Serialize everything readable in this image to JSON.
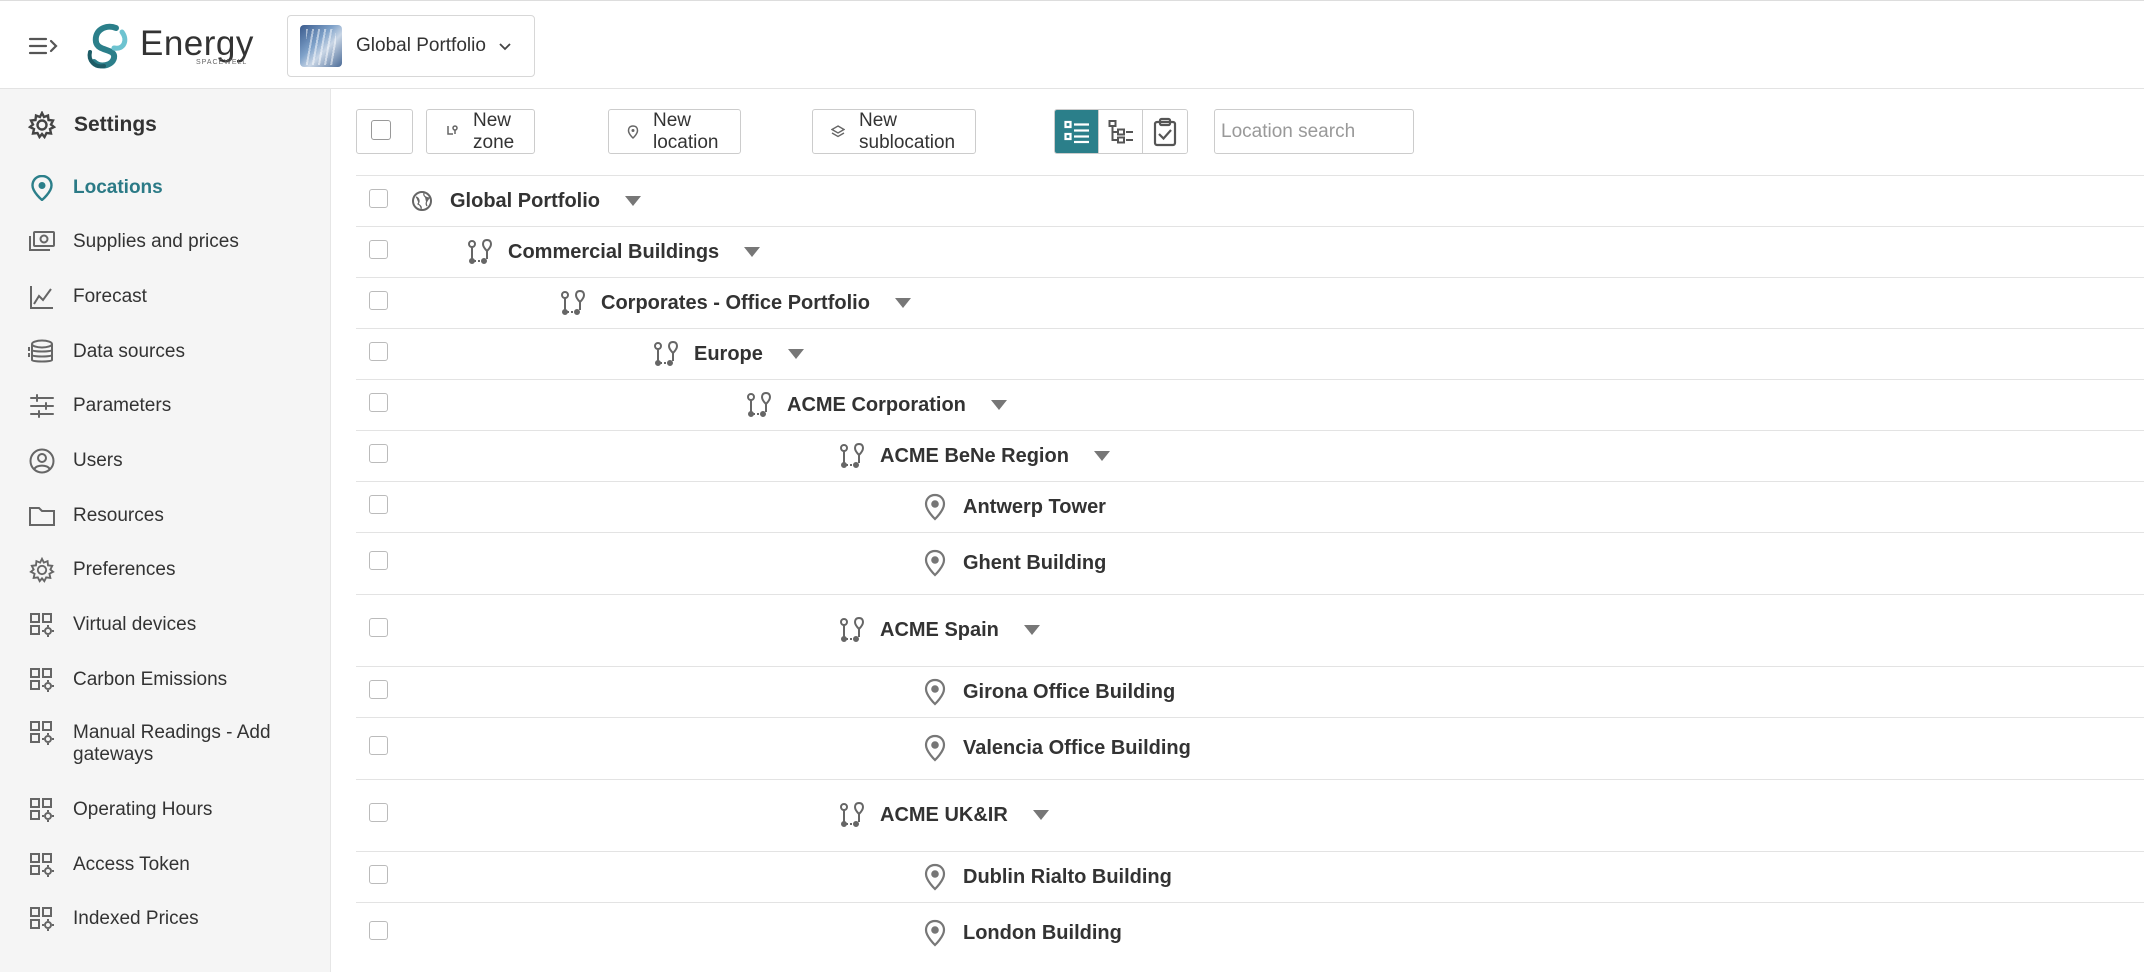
{
  "header": {
    "logo_text": "Energy",
    "logo_sub": "SPACEWELL",
    "portfolio": "Global Portfolio"
  },
  "sidebar": {
    "title": "Settings",
    "items": [
      {
        "label": "Locations",
        "icon": "location-pin-icon",
        "active": true
      },
      {
        "label": "Supplies and prices",
        "icon": "money-icon"
      },
      {
        "label": "Forecast",
        "icon": "chart-icon"
      },
      {
        "label": "Data sources",
        "icon": "database-icon"
      },
      {
        "label": "Parameters",
        "icon": "sliders-icon"
      },
      {
        "label": "Users",
        "icon": "user-icon"
      },
      {
        "label": "Resources",
        "icon": "folder-icon"
      },
      {
        "label": "Preferences",
        "icon": "gear-icon"
      },
      {
        "label": "Virtual devices",
        "icon": "grid-gear-icon"
      },
      {
        "label": "Carbon Emissions",
        "icon": "grid-gear-icon"
      },
      {
        "label": "Manual Readings - Add gateways",
        "icon": "grid-gear-icon"
      },
      {
        "label": "Operating Hours",
        "icon": "grid-gear-icon"
      },
      {
        "label": "Access Token",
        "icon": "grid-gear-icon"
      },
      {
        "label": "Indexed Prices",
        "icon": "grid-gear-icon"
      }
    ]
  },
  "toolbar": {
    "new_zone": "New zone",
    "new_location": "New location",
    "new_sublocation": "New sublocation",
    "search_placeholder": "Location search"
  },
  "tree": [
    {
      "label": "Global Portfolio",
      "type": "portfolio",
      "level": 0,
      "expandable": true
    },
    {
      "label": "Commercial Buildings",
      "type": "zone",
      "level": 1,
      "expandable": true
    },
    {
      "label": "Corporates - Office Portfolio",
      "type": "zone",
      "level": 2,
      "expandable": true
    },
    {
      "label": "Europe",
      "type": "zone",
      "level": 3,
      "expandable": true
    },
    {
      "label": "ACME Corporation",
      "type": "zone",
      "level": 4,
      "expandable": true
    },
    {
      "label": "ACME BeNe Region",
      "type": "zone",
      "level": 5,
      "expandable": true
    },
    {
      "label": "Antwerp Tower",
      "type": "location",
      "level": 6,
      "expandable": false
    },
    {
      "label": "Ghent Building",
      "type": "location",
      "level": 6,
      "expandable": false
    },
    {
      "label": "ACME Spain",
      "type": "zone",
      "level": 5,
      "expandable": true
    },
    {
      "label": "Girona Office Building",
      "type": "location",
      "level": 6,
      "expandable": false
    },
    {
      "label": "Valencia Office Building",
      "type": "location",
      "level": 6,
      "expandable": false
    },
    {
      "label": "ACME UK&IR",
      "type": "zone",
      "level": 5,
      "expandable": true
    },
    {
      "label": "Dublin Rialto Building",
      "type": "location",
      "level": 6,
      "expandable": false
    },
    {
      "label": "London Building",
      "type": "location",
      "level": 6,
      "expandable": false
    }
  ]
}
